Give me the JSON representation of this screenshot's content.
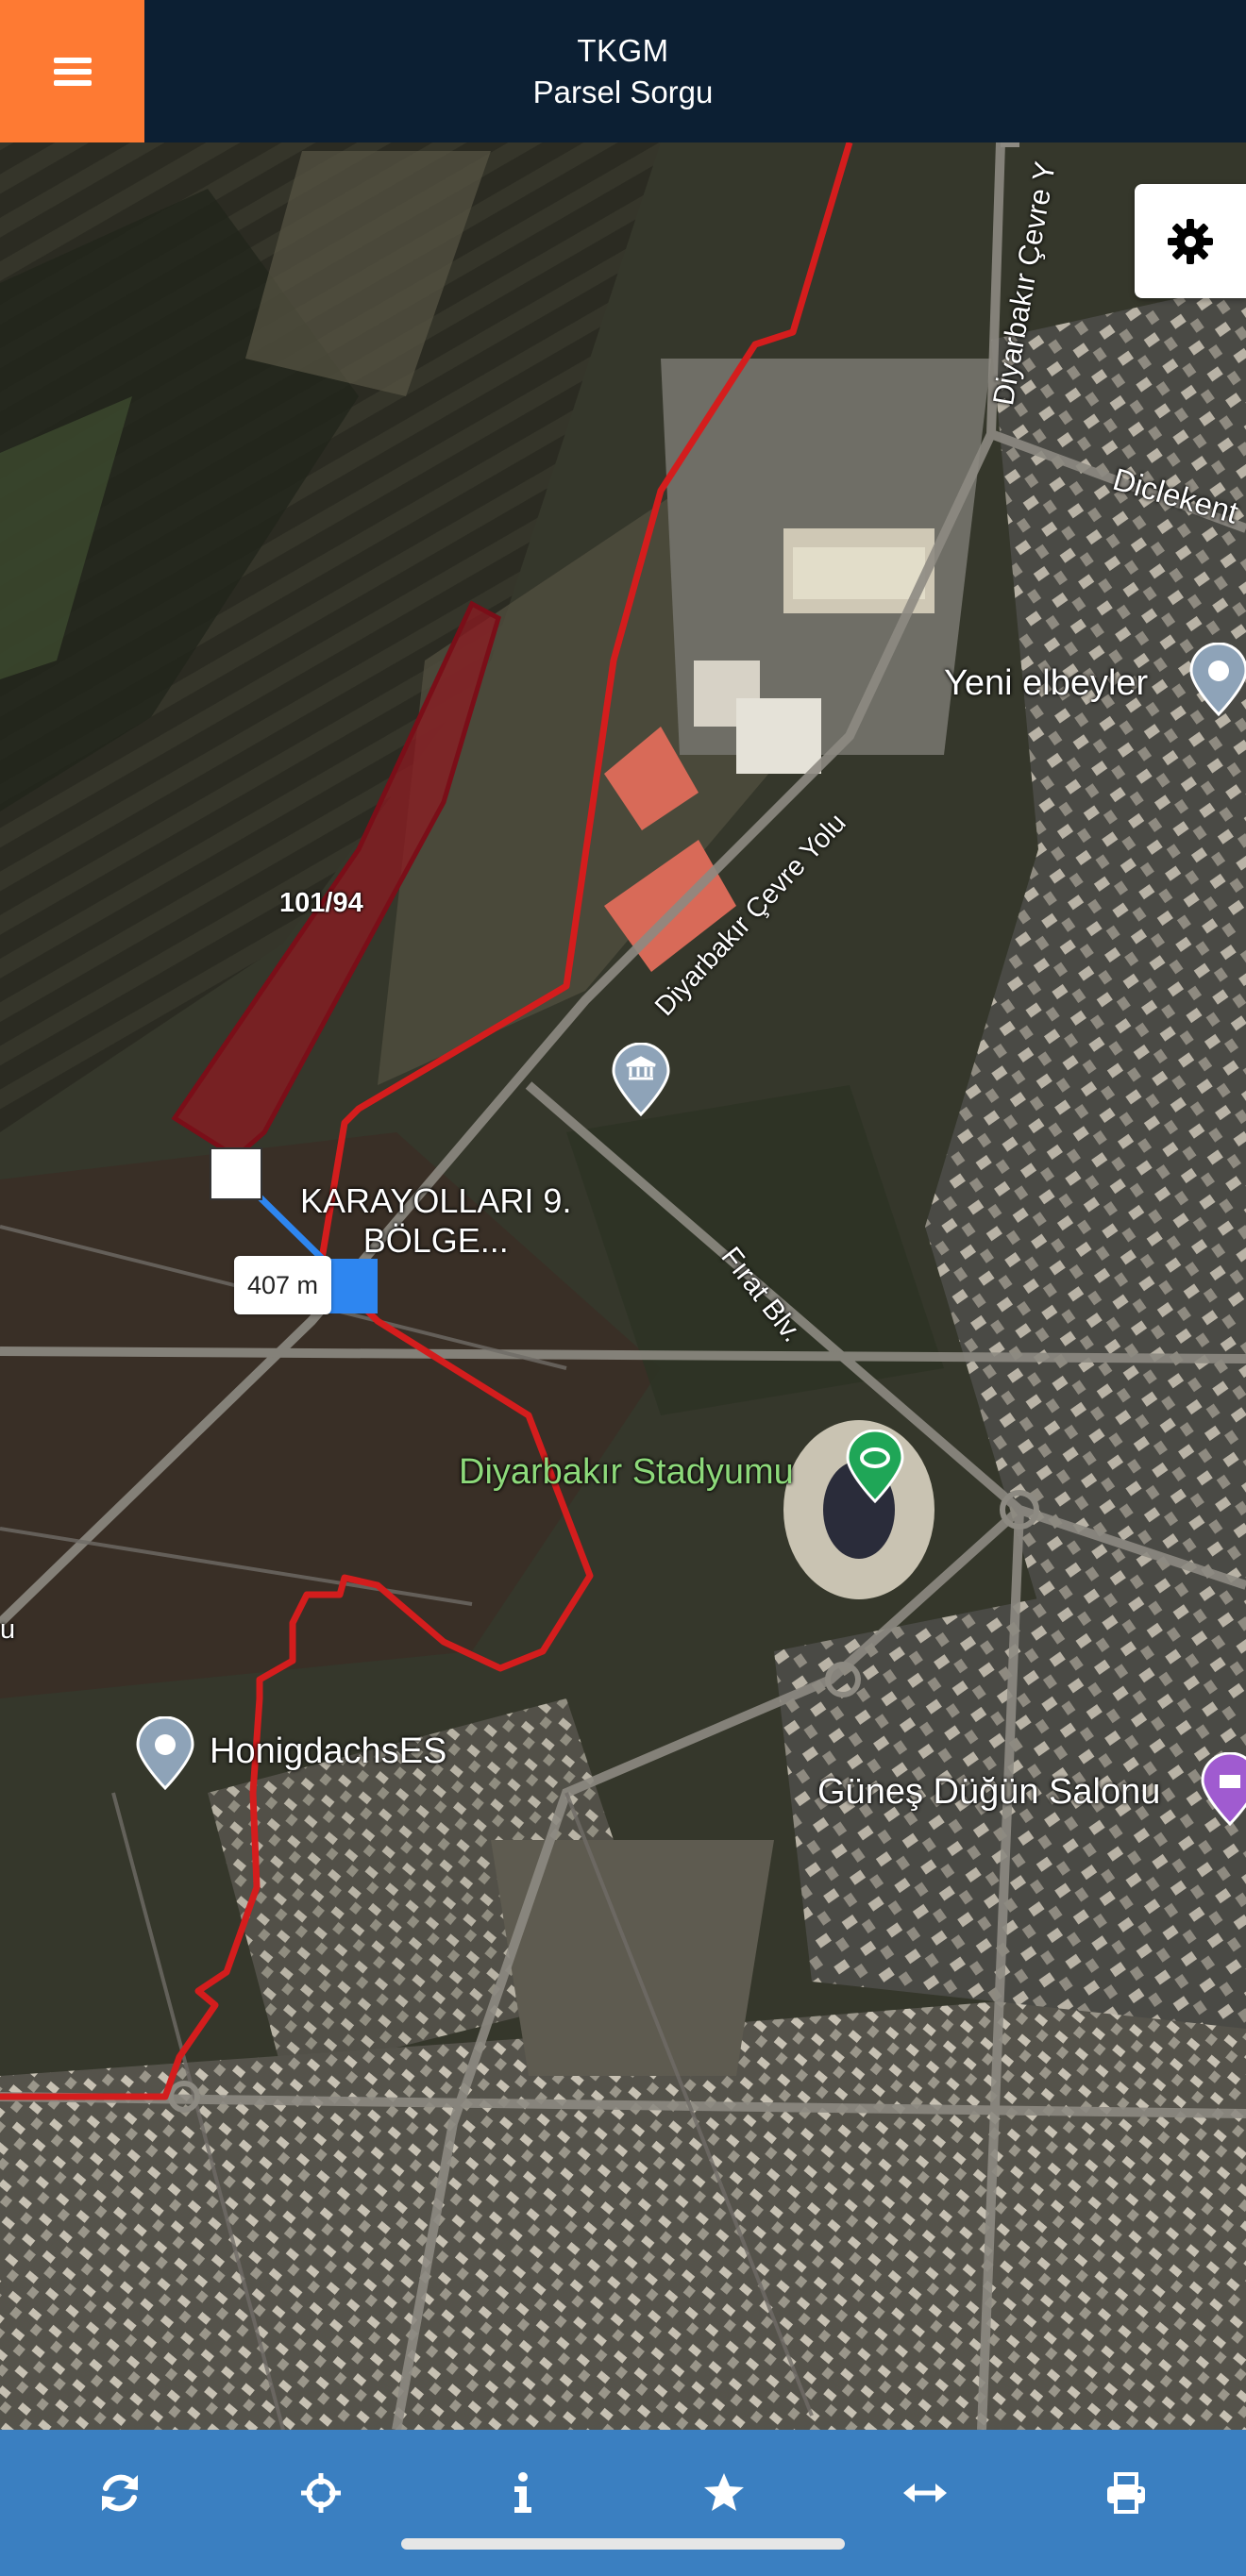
{
  "header": {
    "title": "TKGM",
    "subtitle": "Parsel Sorgu",
    "menu_icon": "hamburger-menu-icon",
    "accent_color": "#fe7a33",
    "background_color": "#0c1f33"
  },
  "map": {
    "settings_icon": "gear-icon",
    "parcel_label": "101/94",
    "measurement": {
      "distance_label": "407 m"
    },
    "poi_labels": {
      "yeni_elbeyler": "Yeni elbeyler",
      "karayollari": "KARAYOLLARI 9.\nBÖLGE...",
      "stadium": "Diyarbakır Stadyumu",
      "honigdachs": "HonigdachsES",
      "gunes": "Güneş Düğün Salonu"
    },
    "road_labels": {
      "cevre_yolu_north": "Diyarbakır Çevre Y",
      "diclekent": "Diclekent",
      "cevre_yolu": "Diyarbakır Çevre Yolu",
      "firat": "Fırat Blv.",
      "west_edge": "u"
    },
    "colors": {
      "boundary_line": "#d41d1d",
      "parcel_fill": "#8e1b22",
      "measure_line": "#2e86f0"
    }
  },
  "toolbar": {
    "items": [
      {
        "icon": "refresh-icon"
      },
      {
        "icon": "crosshair-icon"
      },
      {
        "icon": "info-icon"
      },
      {
        "icon": "star-icon"
      },
      {
        "icon": "measure-arrows-icon"
      },
      {
        "icon": "print-icon"
      }
    ],
    "background_color": "#3a7fc1"
  }
}
